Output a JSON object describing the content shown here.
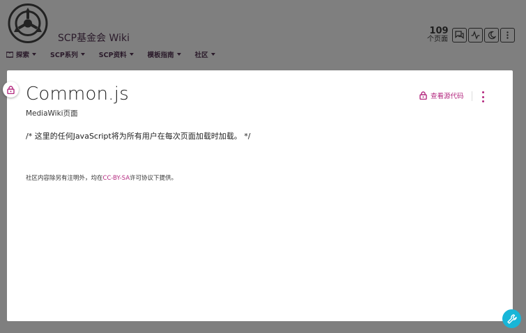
{
  "site": {
    "name": "SCP基金会 Wiki"
  },
  "nav": [
    {
      "label": "探索"
    },
    {
      "label": "SCP系列"
    },
    {
      "label": "SCP资料"
    },
    {
      "label": "模板指南"
    },
    {
      "label": "社区"
    }
  ],
  "stats": {
    "pages_count": "109",
    "pages_label": "个页面"
  },
  "tools": [
    "discussions-icon",
    "activity-icon",
    "dark-mode-icon",
    "more-icon"
  ],
  "page": {
    "title": "Common.js",
    "namespace": "MediaWiki页面",
    "content": "/* 这里的任何JavaScript将为所有用户在每次页面加载时加载。 */",
    "view_source_label": "查看源代码"
  },
  "footer": {
    "prefix": "社区内容除另有注明外，均在",
    "license": "CC-BY-SA",
    "suffix": "许可协议下提供。"
  },
  "colors": {
    "accent": "#b3287f",
    "background": "#7f7f7f",
    "wrench": "#18b6d8"
  }
}
